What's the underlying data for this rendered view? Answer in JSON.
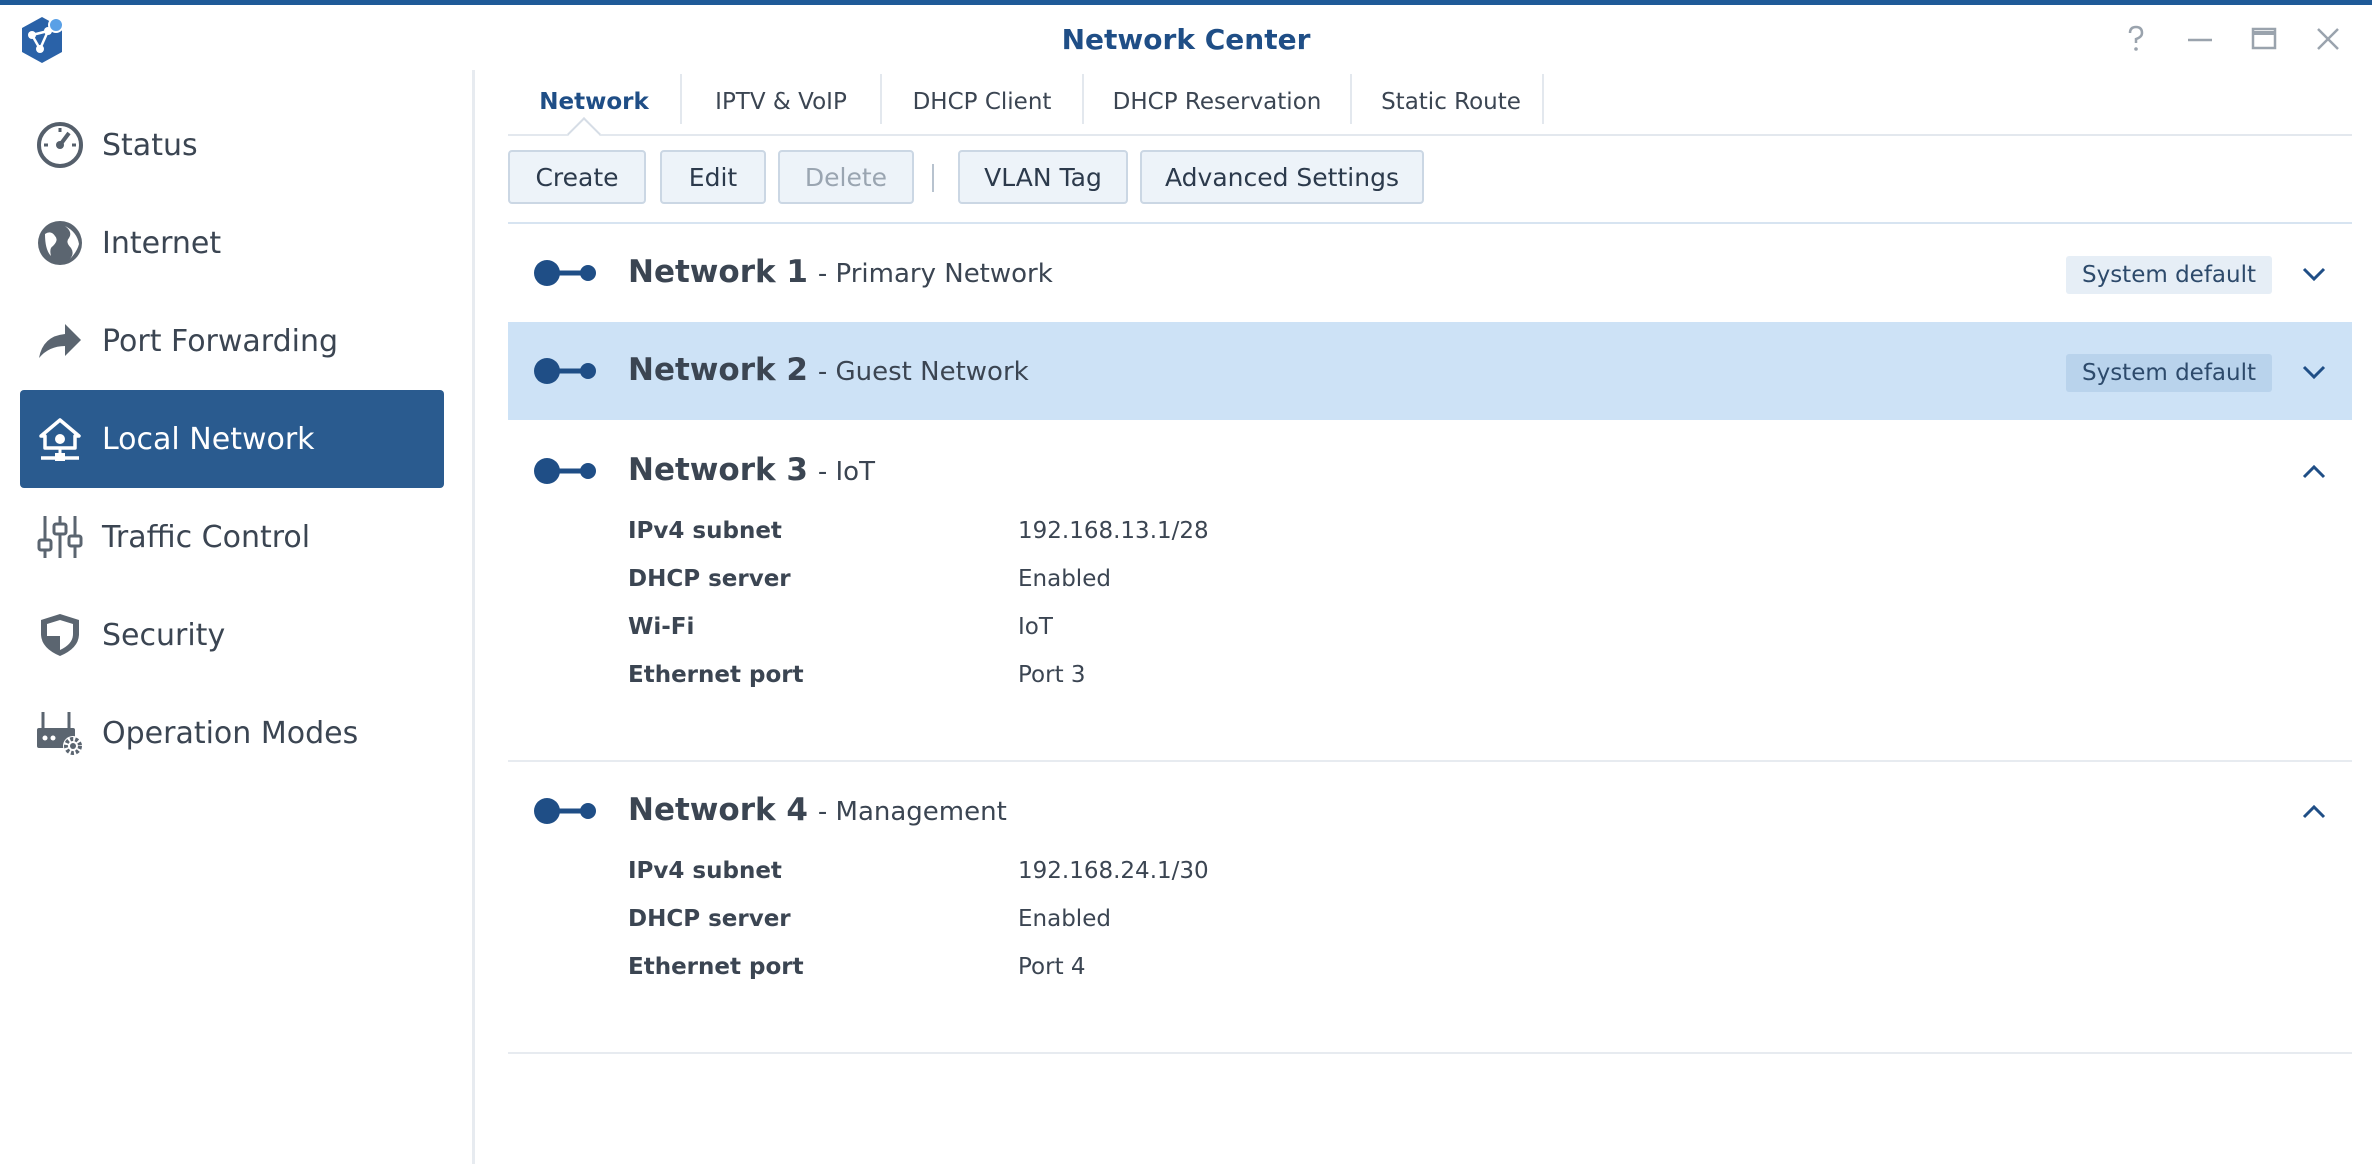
{
  "window": {
    "title": "Network Center"
  },
  "sidebar": {
    "items": [
      {
        "label": "Status",
        "icon": "gauge-icon"
      },
      {
        "label": "Internet",
        "icon": "globe-icon"
      },
      {
        "label": "Port Forwarding",
        "icon": "forward-arrow-icon"
      },
      {
        "label": "Local Network",
        "icon": "home-network-icon",
        "active": true
      },
      {
        "label": "Traffic Control",
        "icon": "sliders-icon"
      },
      {
        "label": "Security",
        "icon": "shield-icon"
      },
      {
        "label": "Operation Modes",
        "icon": "router-gear-icon"
      }
    ]
  },
  "tabs": [
    {
      "label": "Network",
      "active": true
    },
    {
      "label": "IPTV & VoIP"
    },
    {
      "label": "DHCP Client"
    },
    {
      "label": "DHCP Reservation"
    },
    {
      "label": "Static Route"
    }
  ],
  "toolbar": {
    "create": "Create",
    "edit": "Edit",
    "delete": "Delete",
    "vlan_tag": "VLAN Tag",
    "advanced_settings": "Advanced Settings"
  },
  "networks": [
    {
      "name": "Network 1",
      "desc": "- Primary Network",
      "badge": "System default",
      "expanded": false,
      "selected": false
    },
    {
      "name": "Network 2",
      "desc": "- Guest Network",
      "badge": "System default",
      "expanded": false,
      "selected": true
    },
    {
      "name": "Network 3",
      "desc": "- IoT",
      "expanded": true,
      "details": [
        {
          "label": "IPv4 subnet",
          "value": "192.168.13.1/28"
        },
        {
          "label": "DHCP server",
          "value": "Enabled"
        },
        {
          "label": "Wi-Fi",
          "value": "IoT"
        },
        {
          "label": "Ethernet port",
          "value": "Port 3"
        }
      ]
    },
    {
      "name": "Network 4",
      "desc": "- Management",
      "expanded": true,
      "details": [
        {
          "label": "IPv4 subnet",
          "value": "192.168.24.1/30"
        },
        {
          "label": "DHCP server",
          "value": "Enabled"
        },
        {
          "label": "Ethernet port",
          "value": "Port 4"
        }
      ]
    }
  ],
  "colors": {
    "accent": "#2a5b8f",
    "title": "#1f4e86",
    "selected_row": "#cde2f6"
  }
}
